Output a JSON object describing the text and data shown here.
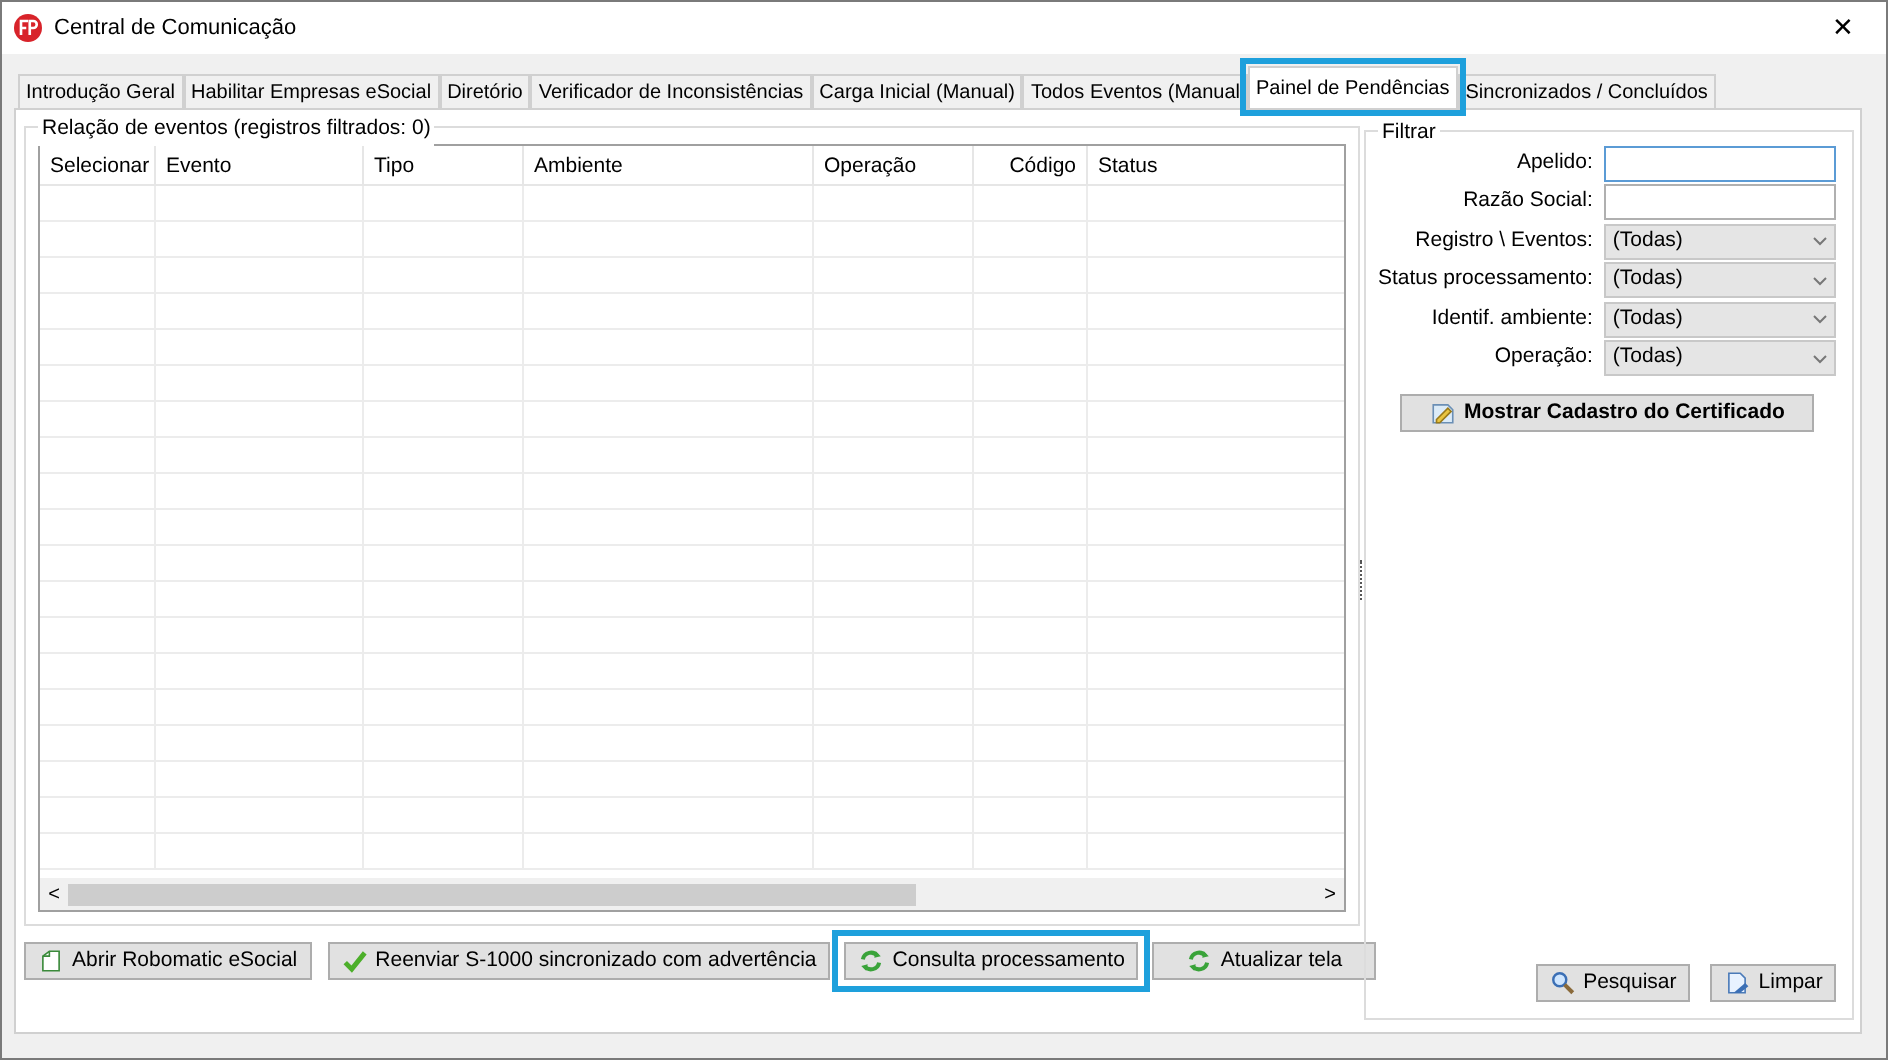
{
  "window": {
    "title": "Central de Comunicação",
    "close": "✕"
  },
  "tabs": [
    {
      "label": "Introdução Geral",
      "selected": false,
      "highlighted": false
    },
    {
      "label": "Habilitar Empresas eSocial",
      "selected": false,
      "highlighted": false
    },
    {
      "label": "Diretório",
      "selected": false,
      "highlighted": false
    },
    {
      "label": "Verificador de Inconsistências",
      "selected": false,
      "highlighted": false
    },
    {
      "label": "Carga Inicial (Manual)",
      "selected": false,
      "highlighted": false
    },
    {
      "label": "Todos Eventos (Manual",
      "selected": false,
      "highlighted": false
    },
    {
      "label": "Painel de Pendências",
      "selected": true,
      "highlighted": true
    },
    {
      "label": "Sincronizados / Concluídos",
      "selected": false,
      "highlighted": false
    }
  ],
  "events": {
    "title": "Relação de eventos (registros filtrados: 0)",
    "columns": [
      "Selecionar",
      "Evento",
      "Tipo",
      "Ambiente",
      "Operação",
      "Código",
      "Status"
    ],
    "scroll_left": "<",
    "scroll_right": ">"
  },
  "buttons": [
    {
      "label": "Abrir Robomatic eSocial",
      "highlighted": false
    },
    {
      "label": "Reenviar S-1000 sincronizado com advertência",
      "highlighted": false
    },
    {
      "label": "Consulta processamento",
      "highlighted": true
    },
    {
      "label": "Atualizar tela",
      "highlighted": false
    }
  ],
  "filter": {
    "title": "Filtrar",
    "fields": [
      {
        "label": "Apelido:",
        "kind": "text",
        "focused": true
      },
      {
        "label": "Razão Social:",
        "kind": "text",
        "focused": false
      },
      {
        "label": "Registro \\ Eventos:",
        "kind": "select",
        "value": "(Todas)"
      },
      {
        "label": "Status processamento:",
        "kind": "select",
        "value": "(Todas)"
      },
      {
        "label": "Identif. ambiente:",
        "kind": "select",
        "value": "(Todas)"
      },
      {
        "label": "Operação:",
        "kind": "select",
        "value": "(Todas)"
      }
    ],
    "certificate_button": "Mostrar Cadastro do Certificado",
    "search_button": "Pesquisar",
    "clear_button": "Limpar"
  }
}
